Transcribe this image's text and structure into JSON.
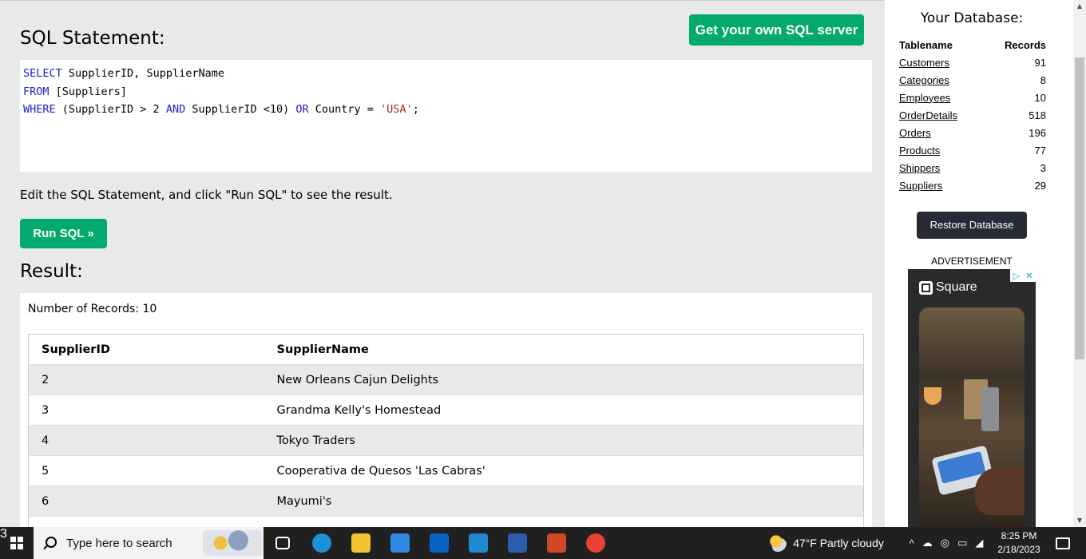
{
  "editor": {
    "sql_heading": "SQL Statement:",
    "own_server_button": "Get your own SQL server",
    "sql_lines": [
      [
        {
          "t": "SELECT",
          "k": "kw"
        },
        {
          "t": " SupplierID, SupplierName",
          "k": ""
        }
      ],
      [
        {
          "t": "FROM",
          "k": "kw"
        },
        {
          "t": " [Suppliers]",
          "k": ""
        }
      ],
      [
        {
          "t": "WHERE",
          "k": "kw"
        },
        {
          "t": " (SupplierID > 2 ",
          "k": ""
        },
        {
          "t": "AND",
          "k": "kw"
        },
        {
          "t": " SupplierID <10) ",
          "k": ""
        },
        {
          "t": "OR",
          "k": "kw"
        },
        {
          "t": " Country = ",
          "k": ""
        },
        {
          "t": "'USA'",
          "k": "str"
        },
        {
          "t": ";",
          "k": ""
        }
      ]
    ],
    "instruction": "Edit the SQL Statement, and click \"Run SQL\" to see the result.",
    "run_button": "Run SQL »"
  },
  "result": {
    "heading": "Result:",
    "record_count": "Number of Records: 10",
    "columns": [
      "SupplierID",
      "SupplierName"
    ],
    "rows": [
      [
        "2",
        "New Orleans Cajun Delights"
      ],
      [
        "3",
        "Grandma Kelly's Homestead"
      ],
      [
        "4",
        "Tokyo Traders"
      ],
      [
        "5",
        "Cooperativa de Quesos 'Las Cabras'"
      ],
      [
        "6",
        "Mayumi's"
      ],
      [
        "",
        ""
      ]
    ]
  },
  "database": {
    "title": "Your Database:",
    "col_tablename": "Tablename",
    "col_records": "Records",
    "tables": [
      {
        "name": "Customers",
        "records": "91"
      },
      {
        "name": "Categories",
        "records": "8"
      },
      {
        "name": "Employees",
        "records": "10"
      },
      {
        "name": "OrderDetails",
        "records": "518"
      },
      {
        "name": "Orders",
        "records": "196"
      },
      {
        "name": "Products",
        "records": "77"
      },
      {
        "name": "Shippers",
        "records": "3"
      },
      {
        "name": "Suppliers",
        "records": "29"
      }
    ],
    "restore_button": "Restore Database",
    "ad_label": "ADVERTISEMENT",
    "ad_brand": "Square"
  },
  "taskbar": {
    "search_placeholder": "Type here to search",
    "apps": [
      {
        "name": "task-view-icon",
        "color": "#ffffff"
      },
      {
        "name": "edge-icon",
        "color": "#1e90d6"
      },
      {
        "name": "file-explorer-icon",
        "color": "#f2c230"
      },
      {
        "name": "store-icon",
        "color": "#2f8ae6"
      },
      {
        "name": "outlook-icon",
        "color": "#0a64c8"
      },
      {
        "name": "vscode-icon",
        "color": "#1f8ad2"
      },
      {
        "name": "word-icon",
        "color": "#2b5cad"
      },
      {
        "name": "powerpoint-icon",
        "color": "#d24726"
      },
      {
        "name": "chrome-icon",
        "color": "#e94235"
      }
    ],
    "weather": "47°F  Partly cloudy",
    "time": "8:25 PM",
    "date": "2/18/2023",
    "notification_count": "3"
  }
}
